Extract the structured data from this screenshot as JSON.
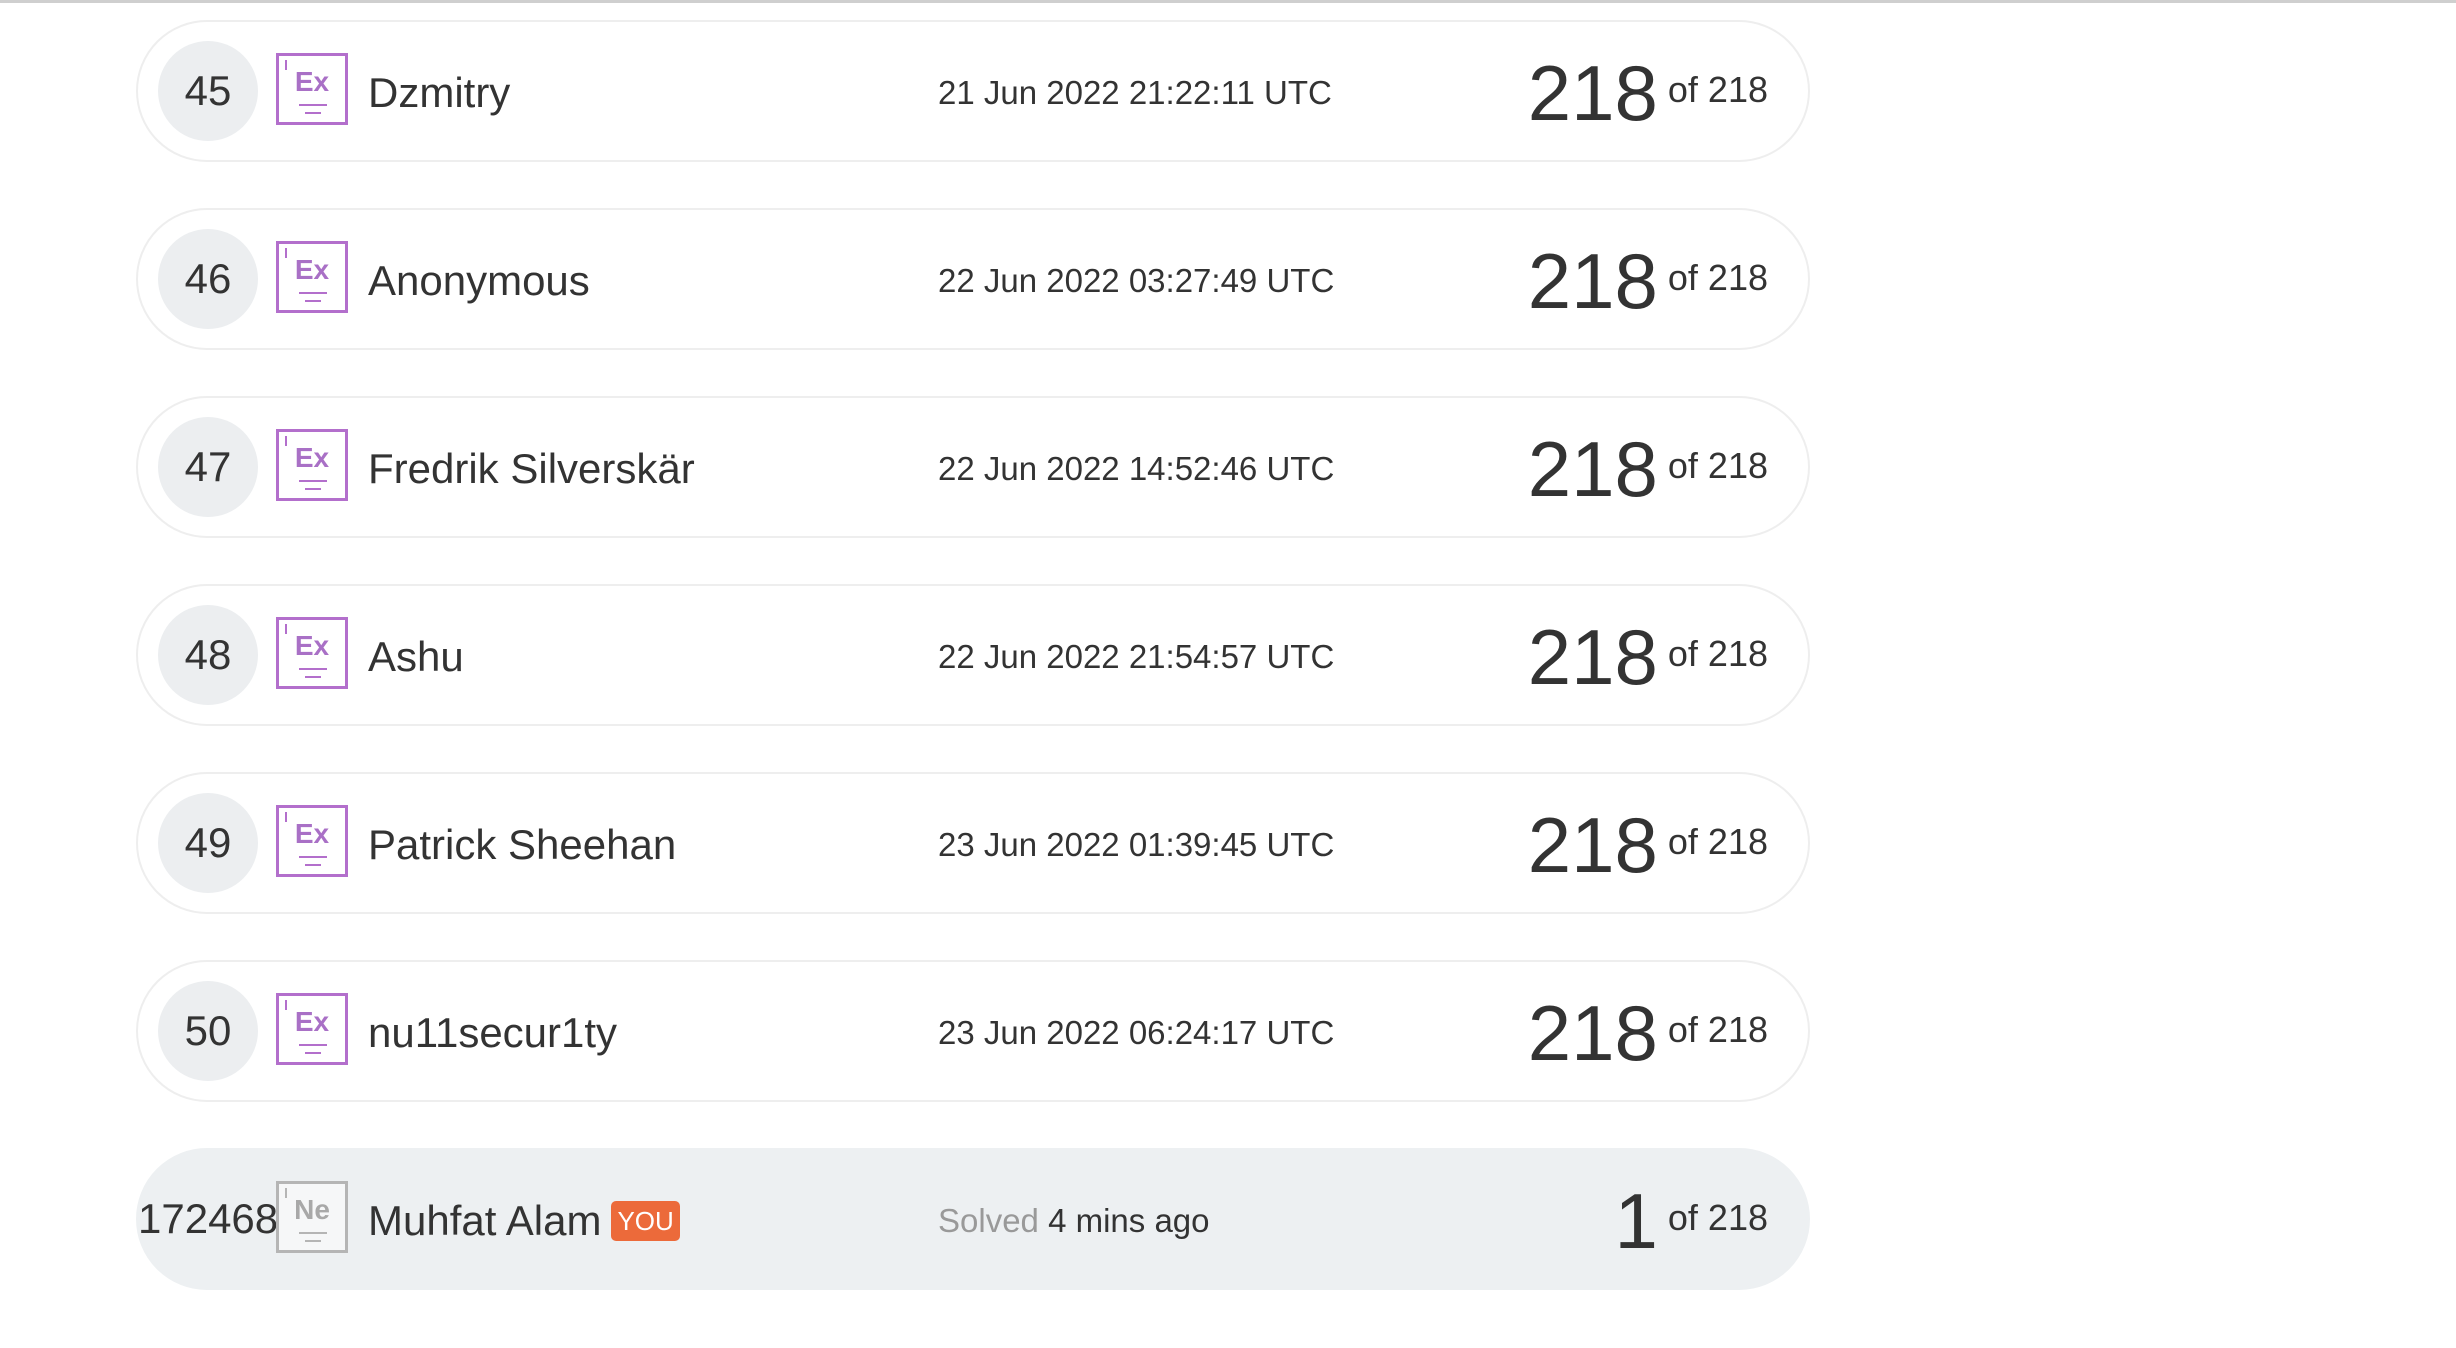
{
  "rows": [
    {
      "rank": "45",
      "icon": "Ex",
      "name": "Dzmitry",
      "date": "21 Jun 2022 21:22:11 UTC",
      "score": "218",
      "of": "of 218"
    },
    {
      "rank": "46",
      "icon": "Ex",
      "name": "Anonymous",
      "date": "22 Jun 2022 03:27:49 UTC",
      "score": "218",
      "of": "of 218"
    },
    {
      "rank": "47",
      "icon": "Ex",
      "name": "Fredrik Silverskär",
      "date": "22 Jun 2022 14:52:46 UTC",
      "score": "218",
      "of": "of 218"
    },
    {
      "rank": "48",
      "icon": "Ex",
      "name": "Ashu",
      "date": "22 Jun 2022 21:54:57 UTC",
      "score": "218",
      "of": "of 218"
    },
    {
      "rank": "49",
      "icon": "Ex",
      "name": "Patrick Sheehan",
      "date": "23 Jun 2022 01:39:45 UTC",
      "score": "218",
      "of": "of 218"
    },
    {
      "rank": "50",
      "icon": "Ex",
      "name": "nu11secur1ty",
      "date": "23 Jun 2022 06:24:17 UTC",
      "score": "218",
      "of": "of 218"
    }
  ],
  "you_row": {
    "rank": "172468",
    "icon": "Ne",
    "name": "Muhfat Alam",
    "badge": "YOU",
    "solved_label": "Solved",
    "solved_time": "4 mins ago",
    "score": "1",
    "of": "of 218"
  },
  "colors": {
    "expert_icon": "#b36fcc",
    "novice_icon": "#b5b5b5",
    "you_badge": "#ec6a3a",
    "you_row_bg": "#edf0f2"
  }
}
